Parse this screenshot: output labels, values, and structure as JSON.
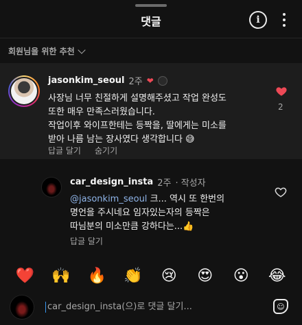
{
  "header": {
    "title": "댓글"
  },
  "recommend": {
    "label": "회원님을 위한 추천"
  },
  "comment": {
    "username": "jasonkim_seoul",
    "time": "2주",
    "lines": [
      "사장님 너무 친절하게 설명해주셨고 작업 완성도",
      "또한 매우 만족스러웠습니다.",
      "작업이후 와이프한테는 등짝을, 딸에게는 미소를",
      "받아 나름 남는 장사였다 생각합니다 😅"
    ],
    "reply_label": "답글 달기",
    "hide_label": "숨기기",
    "like_count": "2"
  },
  "reply": {
    "username": "car_design_insta",
    "time": "2주",
    "author_badge": "· 작성자",
    "mention": "@jasonkim_seoul",
    "first_line_rest": " 크... 역시 또 한번의",
    "lines": [
      "명언을 주시네요 임자있는자의 등짝은",
      "따님분의 미소만큼 강하다는...👍"
    ],
    "reply_label": "답글 달기"
  },
  "emojis": [
    "❤️",
    "🙌",
    "🔥",
    "👏",
    "😢",
    "😍",
    "😮",
    "😂"
  ],
  "input": {
    "placeholder": "car_design_insta(으)로 댓글 달기..."
  },
  "colors": {
    "background": "#121212",
    "highlight": "#1d1d1d",
    "like": "#ed4956",
    "mention": "#8fb4e8"
  }
}
